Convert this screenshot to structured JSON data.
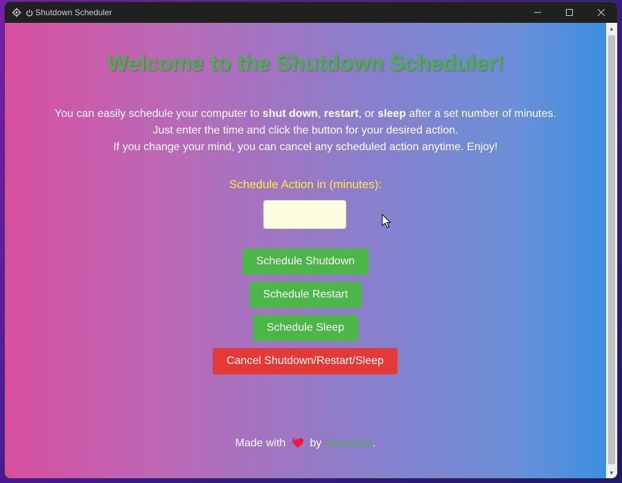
{
  "window": {
    "title": "Shutdown Scheduler",
    "controls": {
      "minimize": "—",
      "maximize": "☐",
      "close": "✕"
    }
  },
  "page": {
    "heading": "Welcome to the Shutdown Scheduler!",
    "intro": {
      "line1_prefix": "You can easily schedule your computer to ",
      "shut_down": "shut down",
      "comma1": ", ",
      "restart": "restart",
      "comma2": ", or ",
      "sleep": "sleep",
      "line1_suffix": " after a set number of minutes.",
      "line2": "Just enter the time and click the button for your desired action.",
      "line3": "If you change your mind, you can cancel any scheduled action anytime. Enjoy!"
    },
    "minutes_label": "Schedule Action in (minutes):",
    "minutes_value": "",
    "buttons": {
      "shutdown": "Schedule Shutdown",
      "restart": "Schedule Restart",
      "sleep": "Schedule Sleep",
      "cancel": "Cancel Shutdown/Restart/Sleep"
    },
    "footer": {
      "made_with": "Made with",
      "by": "by",
      "author": "AbuUsam",
      "period": "."
    }
  },
  "colors": {
    "heading": "#4caf50",
    "label": "#ffeb3b",
    "button_green": "#4cb648",
    "button_red": "#e53935",
    "input_bg": "#fdfde0"
  },
  "icons": {
    "app": "settings-gear-icon",
    "title": "power-icon",
    "footer": "heart-icon",
    "cursor": "mouse-pointer-icon"
  }
}
